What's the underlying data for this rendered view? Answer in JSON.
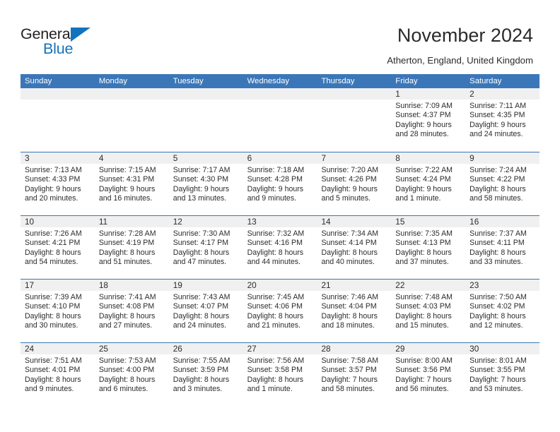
{
  "brand": {
    "name_top": "General",
    "name_bottom": "Blue",
    "accent_color": "#1273bd"
  },
  "header": {
    "title": "November 2024",
    "location": "Atherton, England, United Kingdom"
  },
  "theme": {
    "header_blue": "#3b77b8",
    "band_gray": "#f0f0f0",
    "text": "#2b2b2b"
  },
  "calendar": {
    "weekday_headers": [
      "Sunday",
      "Monday",
      "Tuesday",
      "Wednesday",
      "Thursday",
      "Friday",
      "Saturday"
    ],
    "weeks": [
      [
        {
          "day": "",
          "empty": true,
          "sunrise": "",
          "sunset": "",
          "daylight1": "",
          "daylight2": ""
        },
        {
          "day": "",
          "empty": true,
          "sunrise": "",
          "sunset": "",
          "daylight1": "",
          "daylight2": ""
        },
        {
          "day": "",
          "empty": true,
          "sunrise": "",
          "sunset": "",
          "daylight1": "",
          "daylight2": ""
        },
        {
          "day": "",
          "empty": true,
          "sunrise": "",
          "sunset": "",
          "daylight1": "",
          "daylight2": ""
        },
        {
          "day": "",
          "empty": true,
          "sunrise": "",
          "sunset": "",
          "daylight1": "",
          "daylight2": ""
        },
        {
          "day": "1",
          "empty": false,
          "sunrise": "Sunrise: 7:09 AM",
          "sunset": "Sunset: 4:37 PM",
          "daylight1": "Daylight: 9 hours",
          "daylight2": "and 28 minutes."
        },
        {
          "day": "2",
          "empty": false,
          "sunrise": "Sunrise: 7:11 AM",
          "sunset": "Sunset: 4:35 PM",
          "daylight1": "Daylight: 9 hours",
          "daylight2": "and 24 minutes."
        }
      ],
      [
        {
          "day": "3",
          "empty": false,
          "sunrise": "Sunrise: 7:13 AM",
          "sunset": "Sunset: 4:33 PM",
          "daylight1": "Daylight: 9 hours",
          "daylight2": "and 20 minutes."
        },
        {
          "day": "4",
          "empty": false,
          "sunrise": "Sunrise: 7:15 AM",
          "sunset": "Sunset: 4:31 PM",
          "daylight1": "Daylight: 9 hours",
          "daylight2": "and 16 minutes."
        },
        {
          "day": "5",
          "empty": false,
          "sunrise": "Sunrise: 7:17 AM",
          "sunset": "Sunset: 4:30 PM",
          "daylight1": "Daylight: 9 hours",
          "daylight2": "and 13 minutes."
        },
        {
          "day": "6",
          "empty": false,
          "sunrise": "Sunrise: 7:18 AM",
          "sunset": "Sunset: 4:28 PM",
          "daylight1": "Daylight: 9 hours",
          "daylight2": "and 9 minutes."
        },
        {
          "day": "7",
          "empty": false,
          "sunrise": "Sunrise: 7:20 AM",
          "sunset": "Sunset: 4:26 PM",
          "daylight1": "Daylight: 9 hours",
          "daylight2": "and 5 minutes."
        },
        {
          "day": "8",
          "empty": false,
          "sunrise": "Sunrise: 7:22 AM",
          "sunset": "Sunset: 4:24 PM",
          "daylight1": "Daylight: 9 hours",
          "daylight2": "and 1 minute."
        },
        {
          "day": "9",
          "empty": false,
          "sunrise": "Sunrise: 7:24 AM",
          "sunset": "Sunset: 4:22 PM",
          "daylight1": "Daylight: 8 hours",
          "daylight2": "and 58 minutes."
        }
      ],
      [
        {
          "day": "10",
          "empty": false,
          "sunrise": "Sunrise: 7:26 AM",
          "sunset": "Sunset: 4:21 PM",
          "daylight1": "Daylight: 8 hours",
          "daylight2": "and 54 minutes."
        },
        {
          "day": "11",
          "empty": false,
          "sunrise": "Sunrise: 7:28 AM",
          "sunset": "Sunset: 4:19 PM",
          "daylight1": "Daylight: 8 hours",
          "daylight2": "and 51 minutes."
        },
        {
          "day": "12",
          "empty": false,
          "sunrise": "Sunrise: 7:30 AM",
          "sunset": "Sunset: 4:17 PM",
          "daylight1": "Daylight: 8 hours",
          "daylight2": "and 47 minutes."
        },
        {
          "day": "13",
          "empty": false,
          "sunrise": "Sunrise: 7:32 AM",
          "sunset": "Sunset: 4:16 PM",
          "daylight1": "Daylight: 8 hours",
          "daylight2": "and 44 minutes."
        },
        {
          "day": "14",
          "empty": false,
          "sunrise": "Sunrise: 7:34 AM",
          "sunset": "Sunset: 4:14 PM",
          "daylight1": "Daylight: 8 hours",
          "daylight2": "and 40 minutes."
        },
        {
          "day": "15",
          "empty": false,
          "sunrise": "Sunrise: 7:35 AM",
          "sunset": "Sunset: 4:13 PM",
          "daylight1": "Daylight: 8 hours",
          "daylight2": "and 37 minutes."
        },
        {
          "day": "16",
          "empty": false,
          "sunrise": "Sunrise: 7:37 AM",
          "sunset": "Sunset: 4:11 PM",
          "daylight1": "Daylight: 8 hours",
          "daylight2": "and 33 minutes."
        }
      ],
      [
        {
          "day": "17",
          "empty": false,
          "sunrise": "Sunrise: 7:39 AM",
          "sunset": "Sunset: 4:10 PM",
          "daylight1": "Daylight: 8 hours",
          "daylight2": "and 30 minutes."
        },
        {
          "day": "18",
          "empty": false,
          "sunrise": "Sunrise: 7:41 AM",
          "sunset": "Sunset: 4:08 PM",
          "daylight1": "Daylight: 8 hours",
          "daylight2": "and 27 minutes."
        },
        {
          "day": "19",
          "empty": false,
          "sunrise": "Sunrise: 7:43 AM",
          "sunset": "Sunset: 4:07 PM",
          "daylight1": "Daylight: 8 hours",
          "daylight2": "and 24 minutes."
        },
        {
          "day": "20",
          "empty": false,
          "sunrise": "Sunrise: 7:45 AM",
          "sunset": "Sunset: 4:06 PM",
          "daylight1": "Daylight: 8 hours",
          "daylight2": "and 21 minutes."
        },
        {
          "day": "21",
          "empty": false,
          "sunrise": "Sunrise: 7:46 AM",
          "sunset": "Sunset: 4:04 PM",
          "daylight1": "Daylight: 8 hours",
          "daylight2": "and 18 minutes."
        },
        {
          "day": "22",
          "empty": false,
          "sunrise": "Sunrise: 7:48 AM",
          "sunset": "Sunset: 4:03 PM",
          "daylight1": "Daylight: 8 hours",
          "daylight2": "and 15 minutes."
        },
        {
          "day": "23",
          "empty": false,
          "sunrise": "Sunrise: 7:50 AM",
          "sunset": "Sunset: 4:02 PM",
          "daylight1": "Daylight: 8 hours",
          "daylight2": "and 12 minutes."
        }
      ],
      [
        {
          "day": "24",
          "empty": false,
          "sunrise": "Sunrise: 7:51 AM",
          "sunset": "Sunset: 4:01 PM",
          "daylight1": "Daylight: 8 hours",
          "daylight2": "and 9 minutes."
        },
        {
          "day": "25",
          "empty": false,
          "sunrise": "Sunrise: 7:53 AM",
          "sunset": "Sunset: 4:00 PM",
          "daylight1": "Daylight: 8 hours",
          "daylight2": "and 6 minutes."
        },
        {
          "day": "26",
          "empty": false,
          "sunrise": "Sunrise: 7:55 AM",
          "sunset": "Sunset: 3:59 PM",
          "daylight1": "Daylight: 8 hours",
          "daylight2": "and 3 minutes."
        },
        {
          "day": "27",
          "empty": false,
          "sunrise": "Sunrise: 7:56 AM",
          "sunset": "Sunset: 3:58 PM",
          "daylight1": "Daylight: 8 hours",
          "daylight2": "and 1 minute."
        },
        {
          "day": "28",
          "empty": false,
          "sunrise": "Sunrise: 7:58 AM",
          "sunset": "Sunset: 3:57 PM",
          "daylight1": "Daylight: 7 hours",
          "daylight2": "and 58 minutes."
        },
        {
          "day": "29",
          "empty": false,
          "sunrise": "Sunrise: 8:00 AM",
          "sunset": "Sunset: 3:56 PM",
          "daylight1": "Daylight: 7 hours",
          "daylight2": "and 56 minutes."
        },
        {
          "day": "30",
          "empty": false,
          "sunrise": "Sunrise: 8:01 AM",
          "sunset": "Sunset: 3:55 PM",
          "daylight1": "Daylight: 7 hours",
          "daylight2": "and 53 minutes."
        }
      ]
    ]
  }
}
